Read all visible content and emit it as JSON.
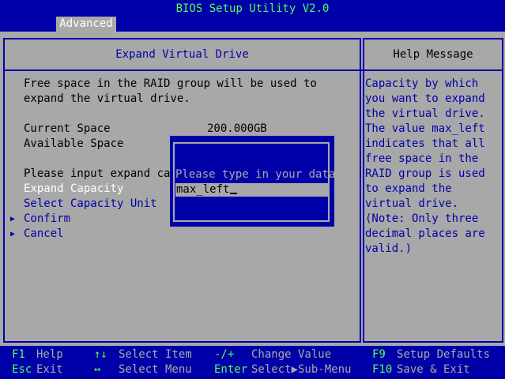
{
  "app_title": "BIOS Setup Utility V2.0",
  "active_tab": "Advanced",
  "left_panel": {
    "title": "Expand Virtual Drive",
    "description_line1": "Free space in the RAID group will be used to",
    "description_line2": "expand the virtual drive.",
    "current_space_label": "Current Space",
    "current_space_value": "200.000GB",
    "available_space_label": "Available Space",
    "prompt_label": "Please input expand cap",
    "items": [
      {
        "label": "Expand Capacity",
        "selected": true
      },
      {
        "label": "Select Capacity Unit"
      },
      {
        "label": "Confirm",
        "arrow": true
      },
      {
        "label": "Cancel",
        "arrow": true
      }
    ],
    "arrow_glyph": "▶"
  },
  "right_panel": {
    "title": "Help Message",
    "lines": [
      "Capacity by which",
      "you want to expand",
      "the virtual drive.",
      "The value max_left",
      "indicates that all",
      "free space in the",
      "RAID group is used",
      "to expand the",
      "virtual drive.",
      "(Note: Only three",
      "decimal places are",
      "valid.)"
    ]
  },
  "popup": {
    "label": "Please type in your data",
    "input_value": "max_left"
  },
  "footer": {
    "row1": [
      {
        "key": "F1",
        "action": "Help"
      },
      {
        "key": "↑↓",
        "action": "Select Item"
      },
      {
        "key": "-/+",
        "action": "Change Value"
      },
      {
        "key": "F9",
        "action": "Setup Defaults"
      }
    ],
    "row2": [
      {
        "key": "Esc",
        "action": "Exit"
      },
      {
        "key": "↔",
        "action": "Select Menu"
      },
      {
        "key": "Enter",
        "action": "Select▶Sub-Menu"
      },
      {
        "key": "F10",
        "action": "Save & Exit"
      }
    ]
  },
  "colors": {
    "bios_blue": "#0000a8",
    "bios_gray": "#a8a8a8",
    "bios_green": "#54fc54",
    "white": "#ffffff"
  }
}
